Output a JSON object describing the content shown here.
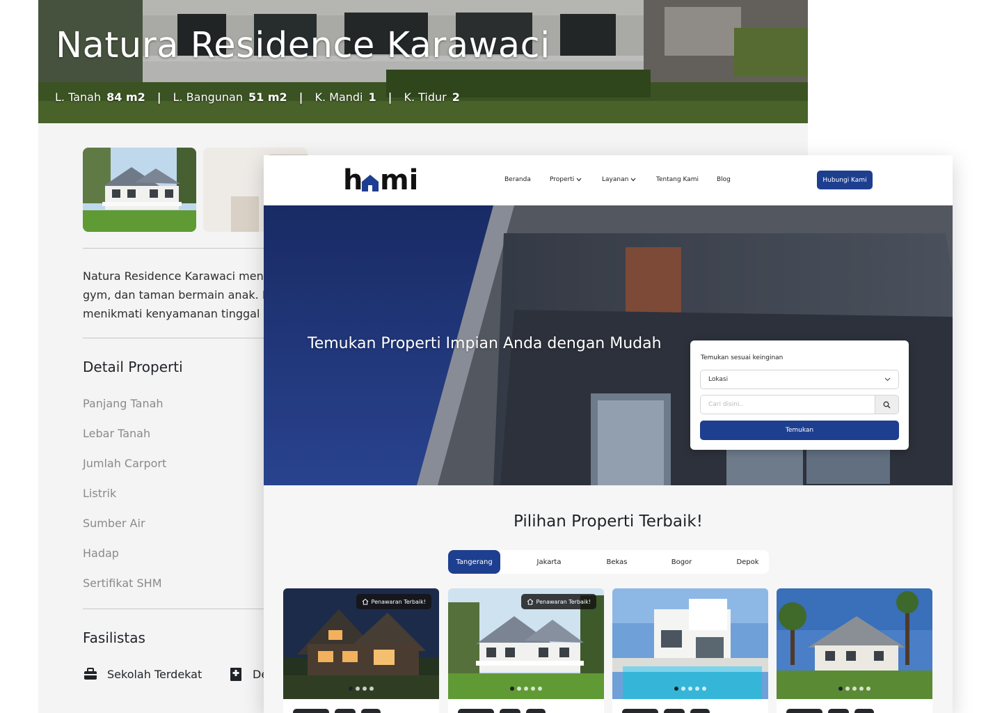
{
  "detail": {
    "title": "Natura Residence Karawaci",
    "specs": [
      {
        "label": "L. Tanah",
        "value": "84 m2"
      },
      {
        "label": "L. Bangunan",
        "value": "51 m2"
      },
      {
        "label": "K. Mandi",
        "value": "1"
      },
      {
        "label": "K. Tidur",
        "value": "2"
      }
    ],
    "spec_separator": "|",
    "description_lines": [
      "Natura Residence Karawaci men",
      "gym, dan taman bermain anak. D",
      "menikmati kenyamanan tinggal d"
    ],
    "detail_heading": "Detail Properti",
    "property_rows": [
      "Panjang Tanah",
      "Lebar Tanah",
      "Jumlah Carport",
      "Listrik",
      "Sumber Air",
      "Hadap",
      "Sertifikat SHM"
    ],
    "facilities_heading": "Fasilistas",
    "facilities": [
      {
        "label": "Sekolah Terdekat",
        "icon": "briefcase-icon"
      },
      {
        "label": "De",
        "icon": "hospital-icon"
      }
    ]
  },
  "home": {
    "logo": {
      "text": "hmi",
      "accent": "#1e3f8f"
    },
    "nav": {
      "items": [
        {
          "label": "Beranda",
          "dropdown": false
        },
        {
          "label": "Properti",
          "dropdown": true
        },
        {
          "label": "Layanan",
          "dropdown": true
        },
        {
          "label": "Tentang Kami",
          "dropdown": false
        },
        {
          "label": "Blog",
          "dropdown": false
        }
      ],
      "contact_label": "Hubungi Kami"
    },
    "hero": {
      "headline": "Temukan Properti Impian Anda dengan Mudah",
      "search": {
        "title": "Temukan sesuai keinginan",
        "location_value": "Lokasi",
        "input_placeholder": "Cari disini..",
        "submit_label": "Temukan"
      }
    },
    "section_title": "Pilihan Properti Terbaik!",
    "tabs": [
      {
        "label": "Tangerang",
        "active": true
      },
      {
        "label": "Jakarta",
        "active": false
      },
      {
        "label": "Bekas",
        "active": false
      },
      {
        "label": "Bogor",
        "active": false
      },
      {
        "label": "Depok",
        "active": false
      }
    ],
    "cards": [
      {
        "badge": "Penawaran Terbaik!",
        "active_dot": 0
      },
      {
        "badge": "Penawaran Terbaik!",
        "active_dot": 0
      },
      {
        "badge": "",
        "active_dot": 0
      },
      {
        "badge": "",
        "active_dot": 0
      }
    ]
  },
  "colors": {
    "primary": "#1e3f8f",
    "dark_text": "#1f2328",
    "muted_text": "#8a8a8a"
  }
}
